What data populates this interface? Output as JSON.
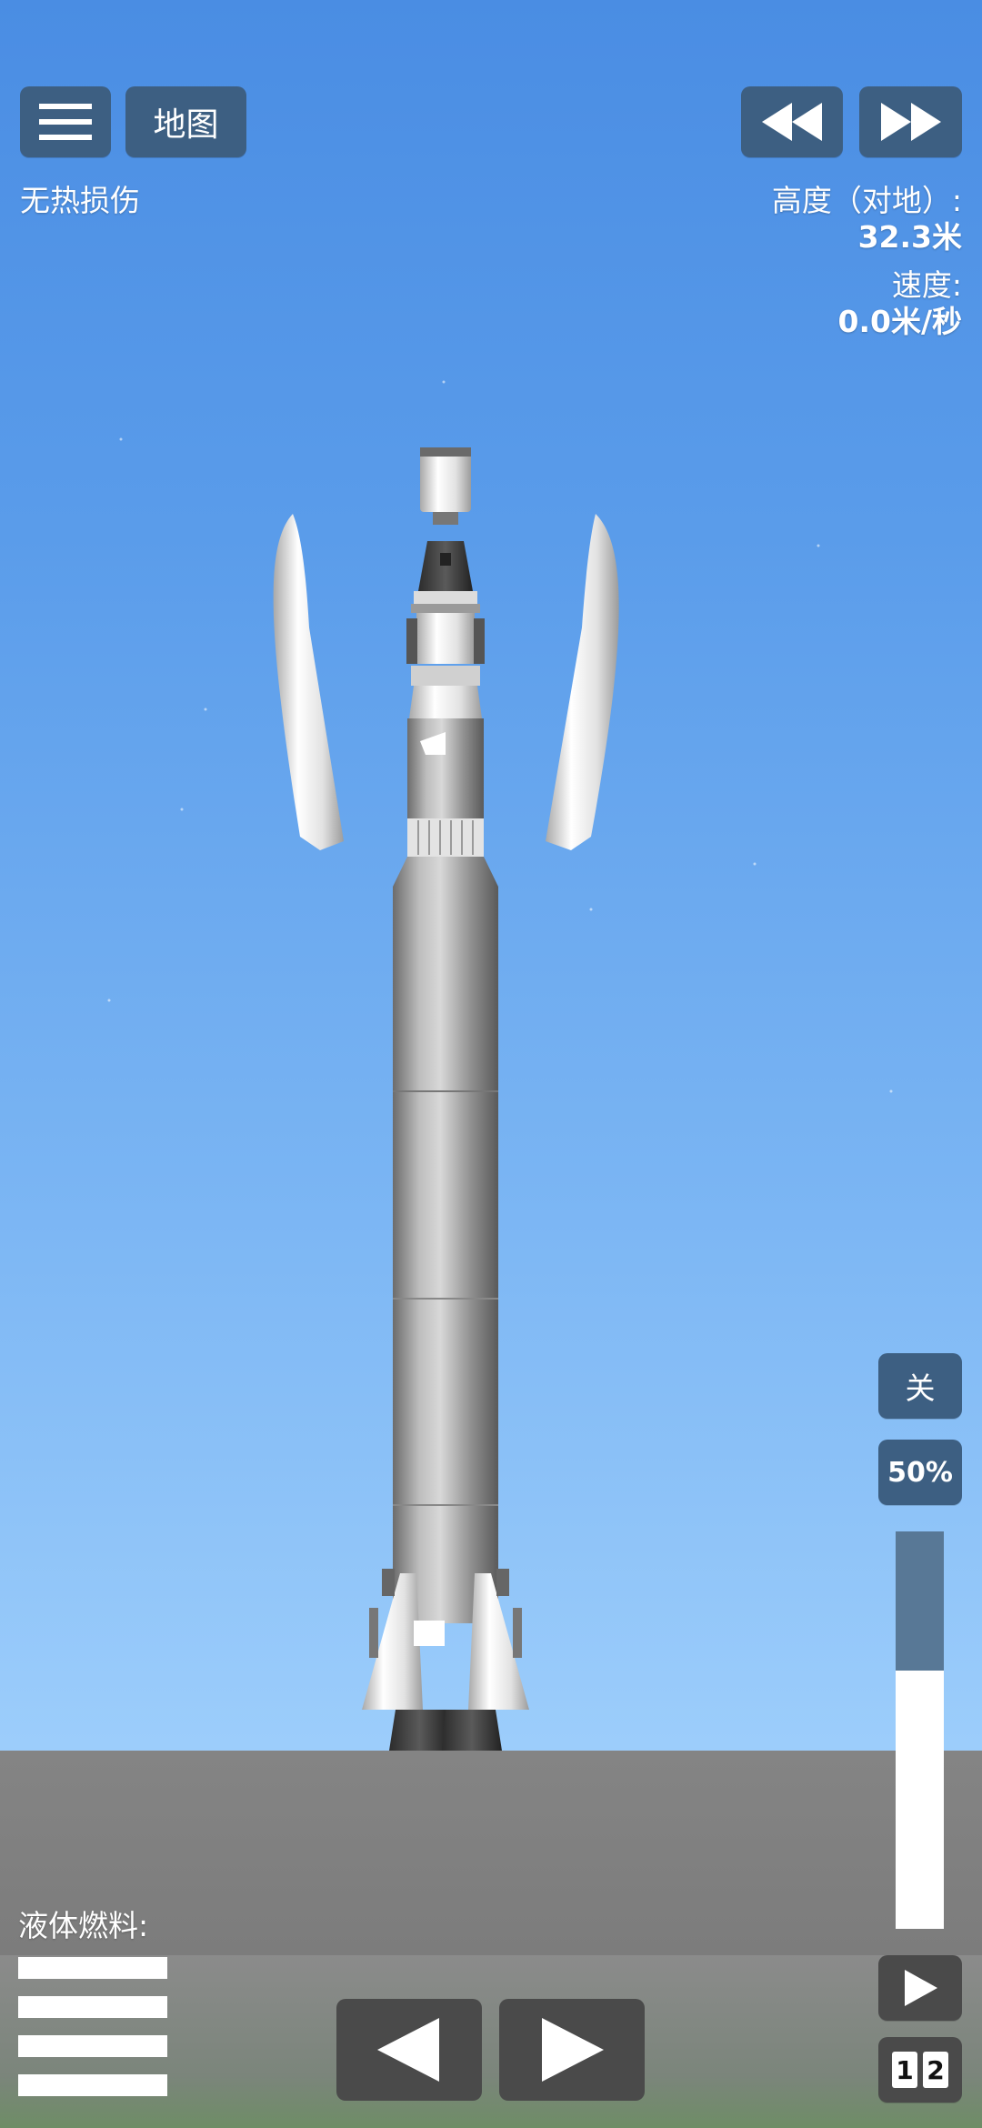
{
  "hud": {
    "map_label": "地图",
    "heat_status": "无热损伤",
    "altitude_label": "高度（对地）:",
    "altitude_value": "32.3米",
    "speed_label": "速度:",
    "speed_value": "0.0米/秒",
    "fuel_label": "液体燃料:"
  },
  "controls": {
    "toggle_label": "关",
    "throttle_percent_label": "50%",
    "throttle_level": 0.35,
    "stage_digit_1": "1",
    "stage_digit_2": "2"
  },
  "icons": {
    "menu": "menu-icon",
    "rewind": "rewind-icon",
    "fast_forward": "fast-forward-icon",
    "prev": "triangle-left-icon",
    "next": "triangle-right-icon",
    "play": "play-icon"
  },
  "colors": {
    "button": "#3d5f82",
    "throttle_fill": "#587896",
    "ground": "#7f7f7f"
  }
}
